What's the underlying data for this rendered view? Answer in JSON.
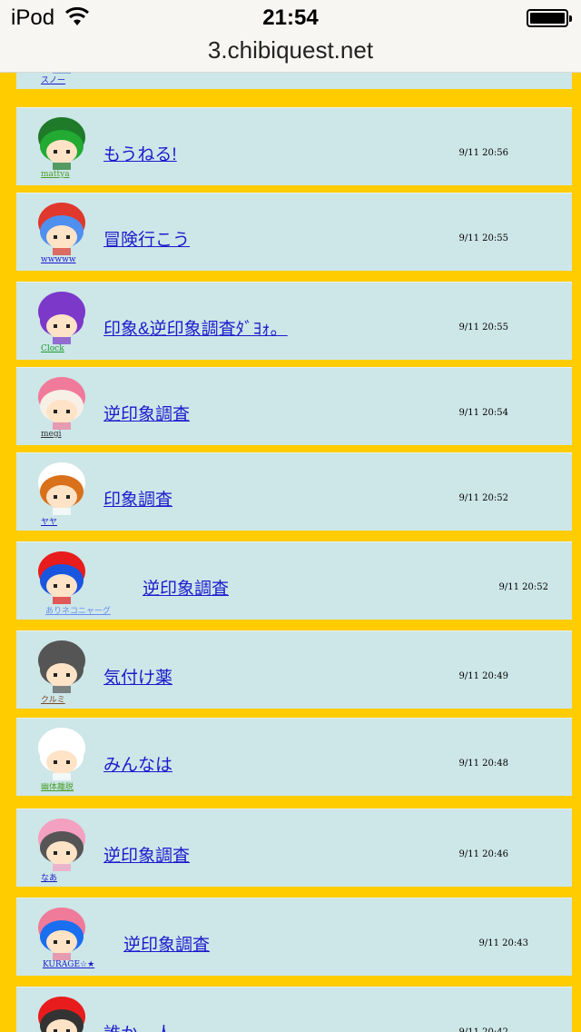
{
  "status_bar": {
    "carrier": "iPod",
    "time": "21:54"
  },
  "address_bar": {
    "url": "3.chibiquest.net"
  },
  "posts": [
    {
      "user": "スノー",
      "title": "",
      "time": "",
      "hair": "#5b8fd6",
      "hat": "#5b8fd6",
      "user_color": "#1b1bcc"
    },
    {
      "user": "mattya",
      "title": "もうねる!",
      "time": "9/11 20:56",
      "hair": "#22aa33",
      "hat": "#1f7a2a",
      "user_color": "#4b9e2b"
    },
    {
      "user": "wwwww",
      "title": "冒険行こう",
      "time": "9/11 20:55",
      "hair": "#4f8ff0",
      "hat": "#e0382c",
      "user_color": "#1b1bcc"
    },
    {
      "user": "Clock",
      "title": "印象&逆印象調査ﾀﾞﾖｫ。",
      "time": "9/11 20:55",
      "hair": "#7b38c9",
      "hat": "#7b38c9",
      "user_color": "#1a9a30"
    },
    {
      "user": "megi",
      "title": "逆印象調査",
      "time": "9/11 20:54",
      "hair": "#f6f0e6",
      "hat": "#f07a9a",
      "user_color": "#333333"
    },
    {
      "user": "ヤヤ",
      "title": "印象調査",
      "time": "9/11 20:52",
      "hair": "#d9701a",
      "hat": "#ffffff",
      "user_color": "#1b1bcc"
    },
    {
      "user": "ありネコニャーグ",
      "title": "逆印象調査",
      "time": "9/11 20:52",
      "hair": "#1a55e0",
      "hat": "#e81c1c",
      "user_color": "#6a8ff0"
    },
    {
      "user": "クルミ",
      "title": "気付け薬",
      "time": "9/11 20:49",
      "hair": "#555555",
      "hat": "#555555",
      "user_color": "#7a4a2a"
    },
    {
      "user": "幽体離脱",
      "title": "みんなは",
      "time": "9/11 20:48",
      "hair": "#ffffff",
      "hat": "#ffffff",
      "user_color": "#4b9e2b"
    },
    {
      "user": "なあ",
      "title": "逆印象調査",
      "time": "9/11 20:46",
      "hair": "#555555",
      "hat": "#f4a0c0",
      "user_color": "#1b1bcc"
    },
    {
      "user": "KURAGE☆★",
      "title": "逆印象調査",
      "time": "9/11 20:43",
      "hair": "#1a6ef0",
      "hat": "#f07a9a",
      "user_color": "#1b1bcc"
    },
    {
      "user": "",
      "title": "誰か一人",
      "time": "9/11 20:42",
      "hair": "#333333",
      "hat": "#e81c1c",
      "user_color": "#1b1bcc"
    }
  ]
}
